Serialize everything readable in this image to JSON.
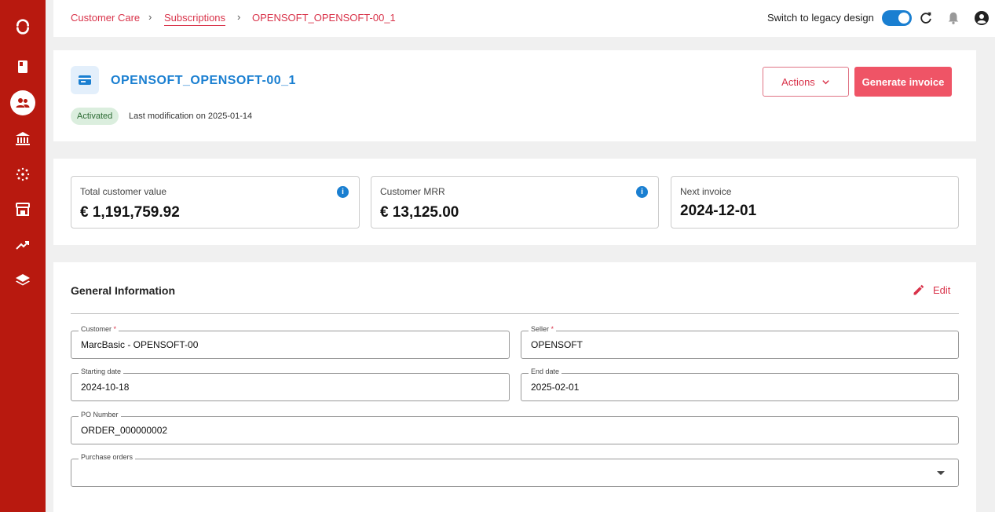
{
  "sidebar": {
    "items": [
      {
        "icon": "logo-icon"
      },
      {
        "icon": "book-icon"
      },
      {
        "icon": "customers-icon",
        "active": true
      },
      {
        "icon": "bank-icon"
      },
      {
        "icon": "network-icon"
      },
      {
        "icon": "store-icon"
      },
      {
        "icon": "trending-up-icon"
      },
      {
        "icon": "layers-icon"
      }
    ]
  },
  "breadcrumb": {
    "items": [
      "Customer Care",
      "Subscriptions",
      "OPENSOFT_OPENSOFT-00_1"
    ]
  },
  "header": {
    "legacy_label": "Switch to legacy design",
    "legacy_enabled": true
  },
  "subscription": {
    "title": "OPENSOFT_OPENSOFT-00_1",
    "status": "Activated",
    "last_modification": "Last modification on 2025-01-14",
    "actions_label": "Actions",
    "generate_label": "Generate invoice"
  },
  "metrics": [
    {
      "label": "Total customer value",
      "value": "€ 1,191,759.92",
      "info": true
    },
    {
      "label": "Customer MRR",
      "value": "€ 13,125.00",
      "info": true
    },
    {
      "label": "Next invoice",
      "value": "2024-12-01",
      "info": false
    }
  ],
  "general": {
    "title": "General Information",
    "edit_label": "Edit",
    "fields": {
      "customer": {
        "label": "Customer",
        "required": "*",
        "value": "MarcBasic - OPENSOFT-00"
      },
      "seller": {
        "label": "Seller",
        "required": "*",
        "value": "OPENSOFT"
      },
      "starting_date": {
        "label": "Starting date",
        "value": "2024-10-18"
      },
      "end_date": {
        "label": "End date",
        "value": "2025-02-01"
      },
      "po_number": {
        "label": "PO Number",
        "value": "ORDER_000000002"
      },
      "purchase_orders": {
        "label": "Purchase orders",
        "value": ""
      }
    }
  },
  "colors": {
    "sidebar": "#b8190f",
    "accent": "#d9334a",
    "primary_button": "#ef5466",
    "title_blue": "#1a7fd1",
    "status_bg": "#dbeede"
  }
}
